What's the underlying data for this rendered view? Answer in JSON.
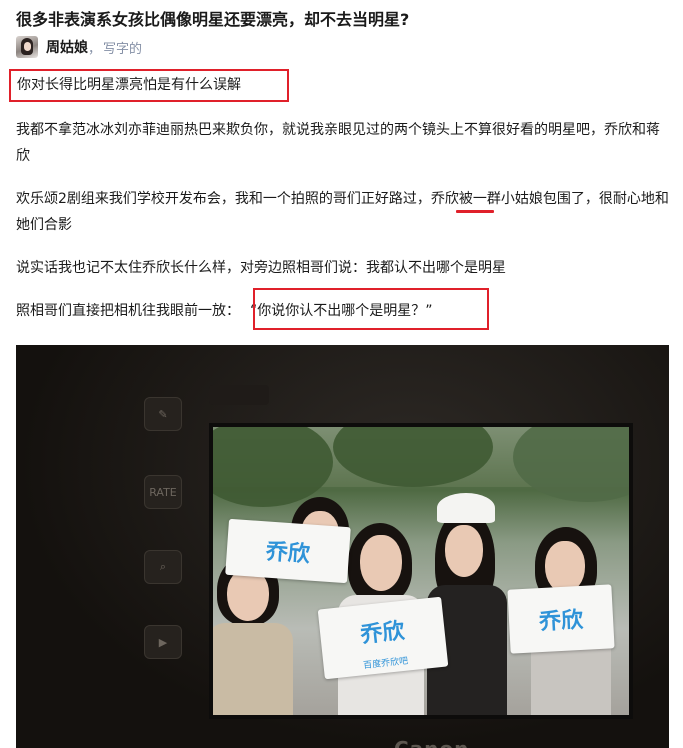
{
  "article": {
    "title": "很多非表演系女孩比偶像明星还要漂亮，却不去当明星?",
    "author": {
      "name": "周姑娘",
      "separator": "，",
      "bio": "写字的"
    }
  },
  "highlight_answer": "你对长得比明星漂亮怕是有什么误解",
  "paragraphs": {
    "p1": "我都不拿范冰冰刘亦菲迪丽热巴来欺负你，就说我亲眼见过的两个镜头上不算很好看的明星吧，乔欣和蒋欣",
    "p2": "欢乐颂2剧组来我们学校开发布会，我和一个拍照的哥们正好路过，乔欣被一群小姑娘包围了，很耐心地和她们合影",
    "p3": "说实话我也记不太住乔欣长什么样，对旁边照相哥们说：我都认不出哪个是明星",
    "p4_prefix": "照相哥们直接把相机往我眼前一放：",
    "p4_quote": "“你说你认不出哪个是明星？”"
  },
  "photo": {
    "signs": [
      "乔欣",
      "乔欣",
      "乔欣"
    ],
    "sign_sub": "百度乔欣吧",
    "brand": "Canon"
  },
  "colors": {
    "highlight_red": "#e0202a",
    "muted_text": "#8590a6",
    "sign_blue": "#2f93d8"
  }
}
